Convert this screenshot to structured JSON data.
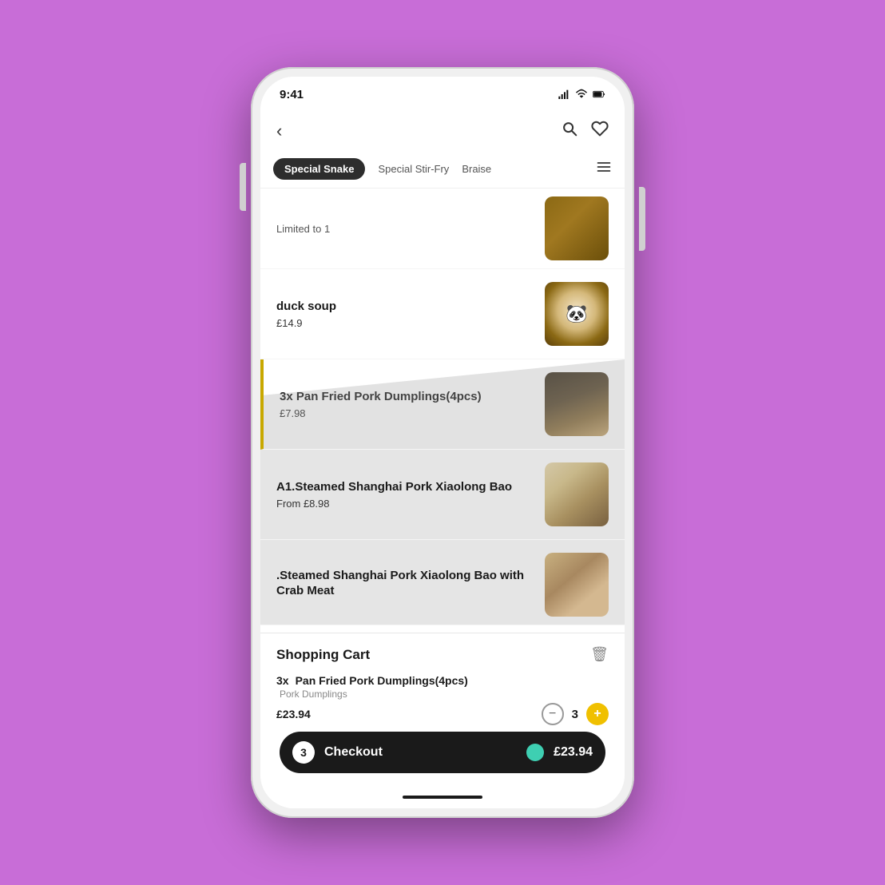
{
  "background_color": "#c86dd7",
  "phone": {
    "status_bar": {
      "time": "9:41",
      "icons": [
        "signal",
        "wifi",
        "battery"
      ]
    },
    "top_nav": {
      "back_icon": "‹",
      "search_icon": "search",
      "heart_icon": "heart"
    },
    "category_tabs": [
      {
        "label": "Special Snake",
        "active": true
      },
      {
        "label": "Special Stir-Fry",
        "active": false
      },
      {
        "label": "Braise",
        "active": false
      }
    ],
    "menu_items": [
      {
        "id": "item-limited",
        "name": "Limited to 1",
        "price": "",
        "limited": true,
        "image_class": "food-img-1",
        "dimmed": false,
        "highlighted": false
      },
      {
        "id": "item-duck-soup",
        "name": "duck soup",
        "price": "£14.9",
        "limited": false,
        "image_class": "food-img-2",
        "dimmed": false,
        "highlighted": false
      },
      {
        "id": "item-pork-dumplings",
        "name": "3x Pan Fried Pork Dumplings(4pcs)",
        "price": "£7.98",
        "limited": false,
        "image_class": "food-img-3",
        "dimmed": true,
        "highlighted": true
      },
      {
        "id": "item-xiaolong-bao",
        "name": "A1.Steamed Shanghai Pork Xiaolong Bao",
        "price": "From £8.98",
        "limited": false,
        "image_class": "food-img-4",
        "dimmed": true,
        "highlighted": false
      },
      {
        "id": "item-xiaolong-crab",
        "name": ".Steamed Shanghai Pork Xiaolong Bao with Crab Meat",
        "price": "",
        "limited": false,
        "image_class": "food-img-5",
        "dimmed": true,
        "highlighted": false
      }
    ],
    "cart": {
      "title": "Shopping Cart",
      "trash_icon": "🗑",
      "item": {
        "quantity": "3x",
        "name": "Pan Fried Pork Dumplings(4pcs)",
        "description": "Pork Dumplings",
        "price": "£23.94",
        "qty_number": "3"
      }
    },
    "checkout_bar": {
      "count": "3",
      "label": "Checkout",
      "price": "£23.94"
    }
  }
}
